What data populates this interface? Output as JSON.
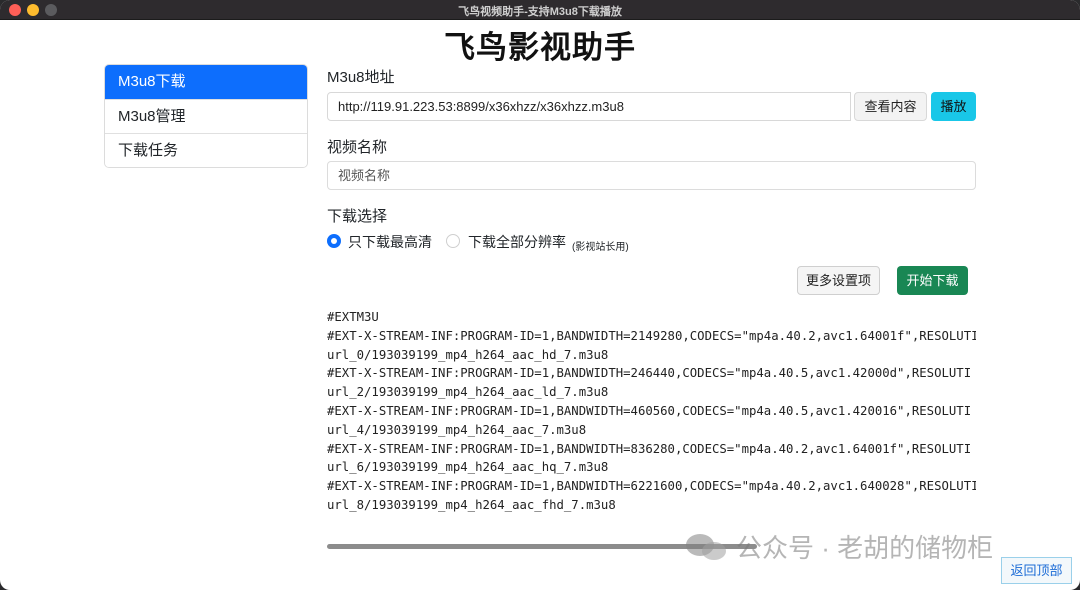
{
  "window": {
    "title": "飞鸟视频助手-支持M3u8下载播放"
  },
  "app": {
    "title": "飞鸟影视助手"
  },
  "sidebar": {
    "items": [
      {
        "label": "M3u8下载"
      },
      {
        "label": "M3u8管理"
      },
      {
        "label": "下载任务"
      }
    ]
  },
  "form": {
    "url_label": "M3u8地址",
    "url_value": "http://119.91.223.53:8899/x36xhzz/x36xhzz.m3u8",
    "view_button": "查看内容",
    "play_button": "播放",
    "name_label": "视频名称",
    "name_placeholder": "视频名称",
    "select_label": "下载选择",
    "option_best": "只下载最高清",
    "option_all": "下载全部分辨率",
    "option_all_note": "(影视站长用)",
    "more_settings_button": "更多设置项",
    "start_download_button": "开始下载"
  },
  "m3u8_lines": [
    "#EXTM3U",
    "#EXT-X-STREAM-INF:PROGRAM-ID=1,BANDWIDTH=2149280,CODECS=\"mp4a.40.2,avc1.64001f\",RESOLUTI",
    "url_0/193039199_mp4_h264_aac_hd_7.m3u8",
    "#EXT-X-STREAM-INF:PROGRAM-ID=1,BANDWIDTH=246440,CODECS=\"mp4a.40.5,avc1.42000d\",RESOLUTI",
    "url_2/193039199_mp4_h264_aac_ld_7.m3u8",
    "#EXT-X-STREAM-INF:PROGRAM-ID=1,BANDWIDTH=460560,CODECS=\"mp4a.40.5,avc1.420016\",RESOLUTI",
    "url_4/193039199_mp4_h264_aac_7.m3u8",
    "#EXT-X-STREAM-INF:PROGRAM-ID=1,BANDWIDTH=836280,CODECS=\"mp4a.40.2,avc1.64001f\",RESOLUTI",
    "url_6/193039199_mp4_h264_aac_hq_7.m3u8",
    "#EXT-X-STREAM-INF:PROGRAM-ID=1,BANDWIDTH=6221600,CODECS=\"mp4a.40.2,avc1.640028\",RESOLUTI",
    "url_8/193039199_mp4_h264_aac_fhd_7.m3u8"
  ],
  "watermark": {
    "text": "公众号 · 老胡的储物柜"
  },
  "back_to_top": "返回顶部",
  "colors": {
    "primary": "#0d6efd",
    "play": "#19c7e8",
    "success": "#198754"
  }
}
